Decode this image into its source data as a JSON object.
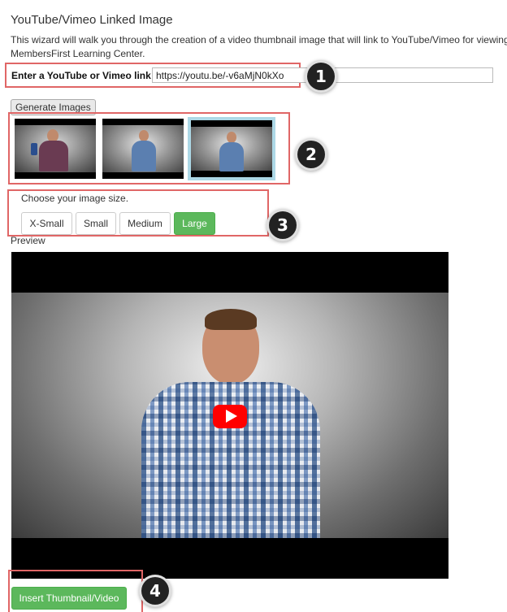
{
  "header": {
    "title": "YouTube/Vimeo Linked Image",
    "intro": "This wizard will walk you through the creation of a video thumbnail image that will link to YouTube/Vimeo for viewing. T\nMembersFirst Learning Center."
  },
  "link": {
    "label": "Enter a YouTube or Vimeo link:",
    "value": "https://youtu.be/-v6aMjN0kXo"
  },
  "generate": {
    "label": "Generate Images"
  },
  "thumbnails": {
    "count": 3,
    "selected_index": 2
  },
  "sizes": {
    "label": "Choose your image size.",
    "options": [
      "X-Small",
      "Small",
      "Medium",
      "Large"
    ],
    "selected": "Large"
  },
  "preview": {
    "label": "Preview"
  },
  "insert": {
    "label": "Insert Thumbnail/Video"
  },
  "steps": [
    "1",
    "2",
    "3",
    "4"
  ],
  "colors": {
    "accent_green": "#5cb85c",
    "highlight_red": "#e06666",
    "selected_thumb_border": "#add8e6",
    "play_red": "#ff0000"
  }
}
